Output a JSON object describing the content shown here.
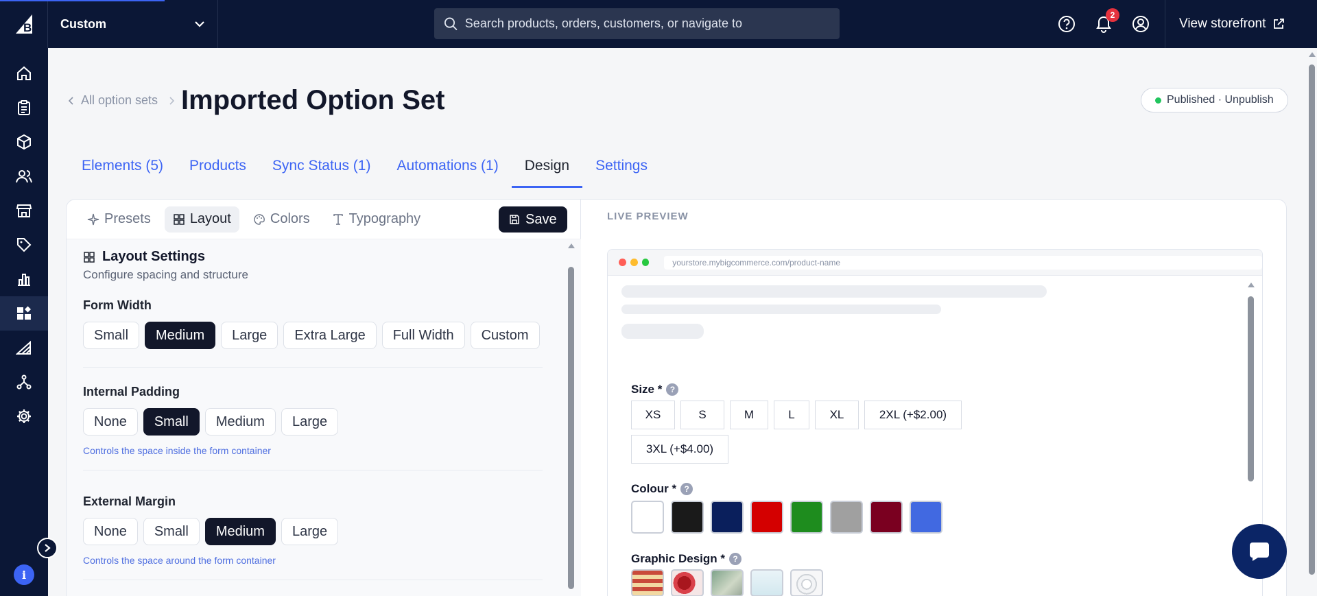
{
  "topbar": {
    "store_name": "Custom",
    "search_placeholder": "Search products, orders, customers, or navigate to",
    "notification_count": "2",
    "view_storefront": "View storefront"
  },
  "breadcrumb": {
    "back_label": "All option sets"
  },
  "page": {
    "title": "Imported Option Set"
  },
  "status": {
    "label": "Published · Unpublish",
    "color": "#22c55e"
  },
  "tabs": [
    {
      "label": "Elements (5)"
    },
    {
      "label": "Products"
    },
    {
      "label": "Sync Status (1)"
    },
    {
      "label": "Automations (1)"
    },
    {
      "label": "Design",
      "active": true
    },
    {
      "label": "Settings"
    }
  ],
  "design": {
    "sub_tabs": [
      {
        "label": "Presets",
        "icon": "sparkles-icon"
      },
      {
        "label": "Layout",
        "icon": "grid-icon",
        "active": true
      },
      {
        "label": "Colors",
        "icon": "palette-icon"
      },
      {
        "label": "Typography",
        "icon": "type-icon"
      }
    ],
    "save_label": "Save",
    "layout": {
      "title": "Layout Settings",
      "subtitle": "Configure spacing and structure",
      "form_width": {
        "label": "Form Width",
        "options": [
          "Small",
          "Medium",
          "Large",
          "Extra Large",
          "Full Width",
          "Custom"
        ],
        "selected": "Medium"
      },
      "internal_padding": {
        "label": "Internal Padding",
        "options": [
          "None",
          "Small",
          "Medium",
          "Large"
        ],
        "selected": "Small",
        "hint": "Controls the space inside the form container"
      },
      "external_margin": {
        "label": "External Margin",
        "options": [
          "None",
          "Small",
          "Medium",
          "Large"
        ],
        "selected": "Medium",
        "hint": "Controls the space around the form container"
      }
    }
  },
  "preview": {
    "label": "LIVE PREVIEW",
    "url": "yourstore.mybigcommerce.com/product-name",
    "size": {
      "label": "Size *",
      "options": [
        "XS",
        "S",
        "M",
        "L",
        "XL",
        "2XL (+$2.00)",
        "3XL (+$4.00)"
      ]
    },
    "colour": {
      "label": "Colour *",
      "swatches": [
        "#ffffff",
        "#1a1a1a",
        "#0a1f5c",
        "#d40000",
        "#1e8c1e",
        "#a0a0a0",
        "#7a0020",
        "#4169e1"
      ]
    },
    "graphic_design": {
      "label": "Graphic Design *"
    }
  },
  "brand": {
    "accent": "#3c64f4",
    "navy": "#0b1736"
  }
}
